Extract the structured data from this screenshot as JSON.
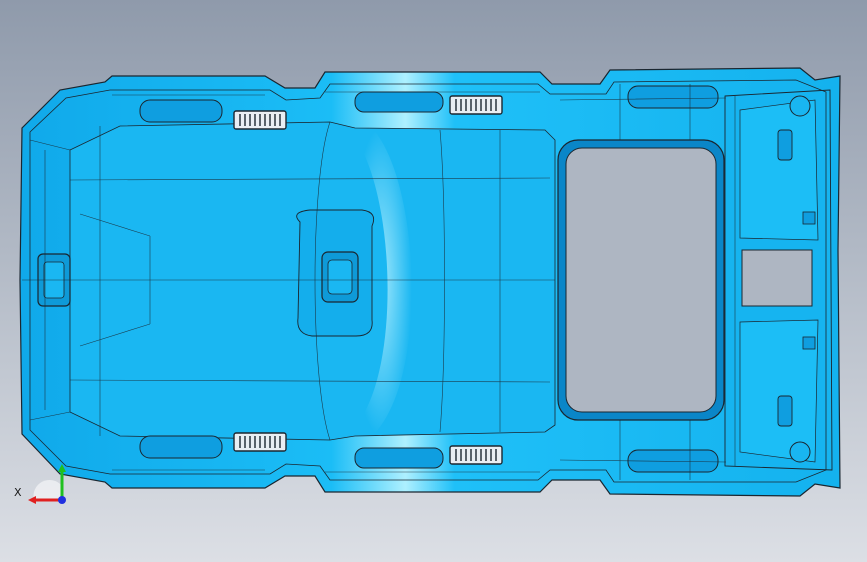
{
  "viewport": {
    "background_top": "#8f9aab",
    "background_bottom": "#dcdfe5"
  },
  "model": {
    "part": "car-roof-headliner",
    "body_color": "#18b8f2",
    "highlight_color": "#8fe6ff",
    "shadow_color": "#0a84c6",
    "edge_color": "#1a2630",
    "opening_color": "#aeb6c2"
  },
  "triad": {
    "x_label": "X",
    "x_color": "#e02020",
    "y_color": "#20c020",
    "z_color": "#2030e0",
    "icon": "coordinate-axes-triad"
  }
}
